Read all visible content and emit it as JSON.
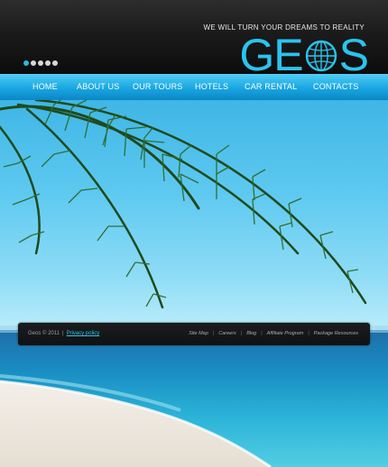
{
  "header": {
    "tagline": "WE WILL TURN YOUR DREAMS TO REALITY",
    "logo_left": "GE",
    "logo_right": "S",
    "accent": "#29c4ef",
    "slider_dots": [
      true,
      false,
      false,
      false,
      false
    ]
  },
  "nav": {
    "items": [
      "HOME",
      "ABOUT US",
      "OUR TOURS",
      "HOTELS",
      "CAR RENTAL",
      "CONTACTS"
    ]
  },
  "footer": {
    "copyright": "Geos © 2011",
    "separator": "|",
    "privacy": "Privacy policy",
    "links": [
      "Site Map",
      "Careers",
      "Blog",
      "Affiliate Program",
      "Package Resources"
    ]
  }
}
